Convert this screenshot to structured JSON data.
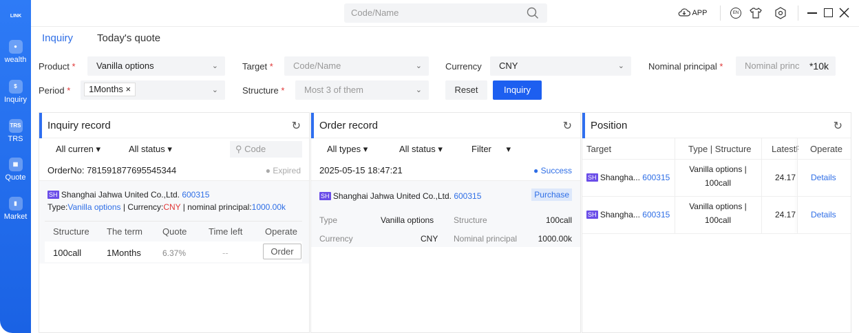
{
  "rail": {
    "logo": "LINK",
    "items": [
      {
        "label": "wealth",
        "icon": "wealth-icon"
      },
      {
        "label": "Inquiry",
        "icon": "inquiry-icon"
      },
      {
        "label": "TRS",
        "icon": "trs-icon",
        "badge": "TRS"
      },
      {
        "label": "Quote",
        "icon": "quote-icon"
      },
      {
        "label": "Market",
        "icon": "market-icon"
      }
    ]
  },
  "topbar": {
    "search_placeholder": "Code/Name",
    "app_label": "APP",
    "lang_badge": "EN"
  },
  "tabs": [
    "Inquiry",
    "Today's quote"
  ],
  "form": {
    "product_label": "Product",
    "product_value": "Vanilla options",
    "target_label": "Target",
    "target_placeholder": "Code/Name",
    "currency_label": "Currency",
    "currency_value": "CNY",
    "nominal_label": "Nominal principal",
    "nominal_placeholder": "Nominal princ",
    "nominal_unit": "*10k",
    "period_label": "Period",
    "period_tag": "1Months",
    "structure_label": "Structure",
    "structure_placeholder": "Most 3 of them",
    "reset_label": "Reset",
    "inquiry_label": "Inquiry",
    "required_mark": "*"
  },
  "inquiry_record": {
    "title": "Inquiry record",
    "filter_currency": "All curren",
    "filter_status": "All status",
    "code_placeholder": "Code",
    "order_no": "OrderNo: 781591877695545344",
    "status": "Expired",
    "company_badge": "SH",
    "company": "Shanghai Jahwa United Co.,Ltd.",
    "code": "600315",
    "type_prefix": "Type:",
    "type_value": "Vanilla options",
    "currency_prefix": " | Currency:",
    "currency_value": "CNY",
    "principal_prefix": " | nominal principal:",
    "principal_value": "1000.00k",
    "columns": [
      "Structure",
      "The term",
      "Quote",
      "Time left",
      "Operate"
    ],
    "row": {
      "structure": "100call",
      "term": "1Months",
      "quote": "6.37%",
      "time_left": "--",
      "operate": "Order"
    }
  },
  "order_record": {
    "title": "Order record",
    "filter_types": "All types",
    "filter_status": "All status",
    "filter_filter": "Filter",
    "datetime": "2025-05-15 18:47:21",
    "status": "Success",
    "company_badge": "SH",
    "company": "Shanghai Jahwa United Co.,Ltd.",
    "code": "600315",
    "action": "Purchase",
    "type_label": "Type",
    "type_value": "Vanilla options",
    "structure_label": "Structure",
    "structure_value": "100call",
    "currency_label": "Currency",
    "currency_value": "CNY",
    "principal_label": "Nominal principal",
    "principal_value": "1000.00k"
  },
  "position": {
    "title": "Position",
    "columns": [
      "Target",
      "Type | Structure",
      "LatestF",
      "Operate"
    ],
    "rows": [
      {
        "badge": "SH",
        "name": "Shangha...",
        "code": "600315",
        "type_line1": "Vanilla options |",
        "type_line2": "100call",
        "latest": "24.17",
        "operate": "Details"
      },
      {
        "badge": "SH",
        "name": "Shangha...",
        "code": "600315",
        "type_line1": "Vanilla options |",
        "type_line2": "100call",
        "latest": "24.17",
        "operate": "Details"
      }
    ]
  },
  "colors": {
    "primary": "#2e6ee6",
    "rail": "#2a74f2",
    "required": "#e03636",
    "sh_badge": "#6a4de8"
  }
}
